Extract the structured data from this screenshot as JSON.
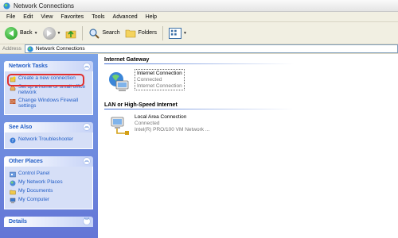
{
  "window": {
    "title": "Network Connections"
  },
  "menu": [
    "File",
    "Edit",
    "View",
    "Favorites",
    "Tools",
    "Advanced",
    "Help"
  ],
  "toolbar": {
    "back_label": "Back",
    "search_label": "Search",
    "folders_label": "Folders"
  },
  "address": {
    "label": "Address",
    "value": "Network Connections"
  },
  "task_pane": {
    "network_tasks": {
      "title": "Network Tasks",
      "items": [
        "Create a new connection",
        "Set up a home or small office network",
        "Change Windows Firewall settings"
      ]
    },
    "see_also": {
      "title": "See Also",
      "items": [
        "Network Troubleshooter"
      ]
    },
    "other_places": {
      "title": "Other Places",
      "items": [
        "Control Panel",
        "My Network Places",
        "My Documents",
        "My Computer"
      ]
    },
    "details": {
      "title": "Details"
    }
  },
  "main": {
    "internet_gateway": {
      "heading": "Internet Gateway",
      "item": {
        "name": "Internet Connection",
        "status": "Connected",
        "type": "Internet Connection"
      }
    },
    "lan": {
      "heading": "LAN or High-Speed Internet",
      "item": {
        "name": "Local Area Connection",
        "status": "Connected",
        "device": "Intel(R) PRO/100 VM Network ..."
      }
    }
  },
  "colors": {
    "task_pane_bg": "#6f8fdf",
    "link_blue": "#215dc6",
    "highlight_red": "#e03030"
  }
}
